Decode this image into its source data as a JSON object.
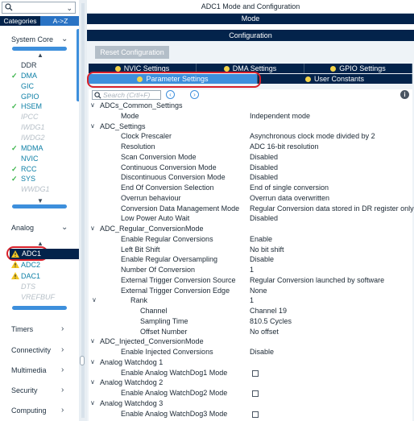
{
  "left_panel": {
    "search": {
      "placeholder": ""
    },
    "tabs": {
      "categories": "Categories",
      "atoz": "A->Z"
    },
    "groups": {
      "system_core": "System Core",
      "analog": "Analog",
      "timers": "Timers",
      "connectivity": "Connectivity",
      "multimedia": "Multimedia",
      "security": "Security",
      "computing": "Computing"
    },
    "system_core_items": [
      {
        "label": "DDR",
        "state": "none"
      },
      {
        "label": "DMA",
        "state": "checked"
      },
      {
        "label": "GIC",
        "state": "none-teal"
      },
      {
        "label": "GPIO",
        "state": "none-teal"
      },
      {
        "label": "HSEM",
        "state": "checked"
      },
      {
        "label": "IPCC",
        "state": "disabled"
      },
      {
        "label": "IWDG1",
        "state": "disabled"
      },
      {
        "label": "IWDG2",
        "state": "disabled"
      },
      {
        "label": "MDMA",
        "state": "checked"
      },
      {
        "label": "NVIC",
        "state": "none-teal"
      },
      {
        "label": "RCC",
        "state": "checked"
      },
      {
        "label": "SYS",
        "state": "checked"
      },
      {
        "label": "WWDG1",
        "state": "disabled"
      }
    ],
    "analog_items": [
      {
        "label": "ADC1",
        "state": "warning-selected"
      },
      {
        "label": "ADC2",
        "state": "warning"
      },
      {
        "label": "DAC1",
        "state": "warning"
      },
      {
        "label": "DTS",
        "state": "disabled"
      },
      {
        "label": "VREFBUF",
        "state": "disabled"
      }
    ]
  },
  "right_panel": {
    "window_title": "ADC1 Mode and Configuration",
    "mode_label": "Mode",
    "configuration_label": "Configuration",
    "reset_button": "Reset Configuration",
    "tabs_row1": [
      "NVIC Settings",
      "DMA Settings",
      "GPIO Settings"
    ],
    "tabs_row2": [
      "Parameter Settings",
      "User Constants"
    ],
    "selected_tab": "Parameter Settings",
    "search_placeholder": "Search (Crtl+F)",
    "info_icon": "i"
  },
  "parameters": [
    {
      "level": 0,
      "expand": "v",
      "key": "ADCs_Common_Settings",
      "value": ""
    },
    {
      "level": 2,
      "key": "Mode",
      "value": "Independent mode"
    },
    {
      "level": 0,
      "expand": "v",
      "key": "ADC_Settings",
      "value": ""
    },
    {
      "level": 2,
      "key": "Clock Prescaler",
      "value": "Asynchronous clock mode divided by 2"
    },
    {
      "level": 2,
      "key": "Resolution",
      "value": "ADC 16-bit resolution"
    },
    {
      "level": 2,
      "key": "Scan Conversion Mode",
      "value": "Disabled"
    },
    {
      "level": 2,
      "key": "Continuous Conversion Mode",
      "value": "Disabled"
    },
    {
      "level": 2,
      "key": "Discontinuous Conversion Mode",
      "value": "Disabled"
    },
    {
      "level": 2,
      "key": "End Of Conversion Selection",
      "value": "End of single conversion"
    },
    {
      "level": 2,
      "key": "Overrun behaviour",
      "value": "Overrun data overwritten"
    },
    {
      "level": 2,
      "key": "Conversion Data Management Mode",
      "value": "Regular Conversion data stored in DR register only"
    },
    {
      "level": 2,
      "key": "Low Power Auto Wait",
      "value": "Disabled"
    },
    {
      "level": 0,
      "expand": "v",
      "key": "ADC_Regular_ConversionMode",
      "value": ""
    },
    {
      "level": 2,
      "key": "Enable Regular Conversions",
      "value": "Enable"
    },
    {
      "level": 2,
      "key": "Left Bit Shift",
      "value": "No bit shift"
    },
    {
      "level": 2,
      "key": "Enable Regular Oversampling",
      "value": "Disable"
    },
    {
      "level": 2,
      "key": "Number Of Conversion",
      "value": "1"
    },
    {
      "level": 2,
      "key": "External Trigger Conversion Source",
      "value": "Regular Conversion launched by software"
    },
    {
      "level": 2,
      "key": "External Trigger Conversion Edge",
      "value": "None"
    },
    {
      "level": 3,
      "expand": "v",
      "key": "Rank",
      "value": "1"
    },
    {
      "level": 4,
      "key": "Channel",
      "value": "Channel 19"
    },
    {
      "level": 4,
      "key": "Sampling Time",
      "value": "810.5 Cycles"
    },
    {
      "level": 4,
      "key": "Offset Number",
      "value": "No offset"
    },
    {
      "level": 0,
      "expand": "v",
      "key": "ADC_Injected_ConversionMode",
      "value": ""
    },
    {
      "level": 2,
      "key": "Enable Injected Conversions",
      "value": "Disable"
    },
    {
      "level": 0,
      "expand": "v",
      "key": "Analog Watchdog 1",
      "value": ""
    },
    {
      "level": 2,
      "key": "Enable Analog WatchDog1 Mode",
      "value": "",
      "checkbox": true
    },
    {
      "level": 0,
      "expand": "v",
      "key": "Analog Watchdog 2",
      "value": ""
    },
    {
      "level": 2,
      "key": "Enable Analog WatchDog2 Mode",
      "value": "",
      "checkbox": true
    },
    {
      "level": 0,
      "expand": "v",
      "key": "Analog Watchdog 3",
      "value": ""
    },
    {
      "level": 2,
      "key": "Enable Analog WatchDog3 Mode",
      "value": "",
      "checkbox": true
    }
  ],
  "colors": {
    "navy": "#03234b",
    "accent_blue": "#3d8fdc",
    "highlight_red": "#d8202a",
    "check_green": "#3bb44a",
    "warning_yellow": "#f3c623"
  }
}
